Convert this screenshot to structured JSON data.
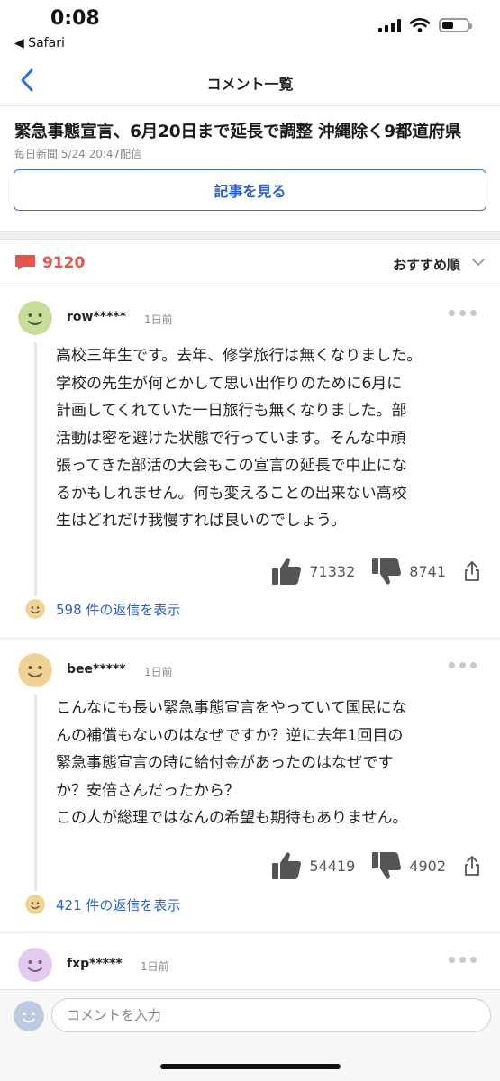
{
  "status_bar": {
    "time": "0:08",
    "back_app": "◀ Safari",
    "battery_level": 0.45
  },
  "nav": {
    "title": "コメント一覧"
  },
  "article": {
    "title": "緊急事態宣言、6月20日まで延長で調整 沖縄除く9都道府県",
    "meta": "毎日新聞 5/24 20:47配信",
    "view_label": "記事を見る"
  },
  "comments_header": {
    "count": "9120",
    "sort_label": "おすすめ順",
    "count_color": "#e5534b"
  },
  "comments": [
    {
      "username": "row*****",
      "time": "1日前",
      "avatar_color": "#c9dd9a",
      "lines": [
        "高校三年生です。去年、修学旅行は無くなりました。",
        "学校の先生が何とかして思い出作りのために6月に",
        "計画してくれていた一日旅行も無くなりました。部",
        "活動は密を避けた状態で行っています。そんな中頑",
        "張ってきた部活の大会もこの宣言の延長で中止にな",
        "るかもしれません。何も変えることの出来ない高校",
        "生はどれだけ我慢すれば良いのでしょう。"
      ],
      "likes": "71332",
      "dislikes": "8741",
      "replies": "598 件の返信を表示"
    },
    {
      "username": "bee*****",
      "time": "1日前",
      "avatar_color": "#f0d394",
      "lines": [
        "こんなにも長い緊急事態宣言をやっていて国民にな",
        "んの補償もないのはなぜですか？逆に去年1回目の",
        "緊急事態宣言の時に給付金があったのはなぜです",
        "か？安倍さんだったから？",
        "この人が総理ではなんの希望も期待もありません。"
      ],
      "likes": "54419",
      "dislikes": "4902",
      "replies": "421 件の返信を表示"
    },
    {
      "username": "fxp*****",
      "time": "1日前",
      "avatar_color": "#e2c9ee"
    }
  ],
  "input": {
    "placeholder": "コメントを入力"
  },
  "reply_avatar_color": "#f0d394",
  "input_avatar_color": "#bccbe0"
}
